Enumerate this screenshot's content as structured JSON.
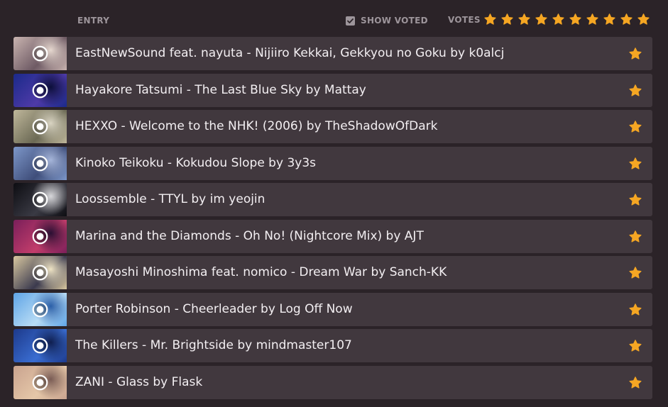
{
  "header": {
    "entry_label": "ENTRY",
    "show_voted_label": "SHOW VOTED",
    "show_voted_checked": true,
    "votes_label": "VOTES",
    "vote_scale_max": 10
  },
  "colors": {
    "background": "#2b2328",
    "row": "#41383e",
    "accent_star": "#f5a623",
    "muted_text": "#9d959b",
    "title_text": "#f3eff2"
  },
  "entries": [
    {
      "title": "EastNewSound feat. nayuta - Nijiiro Kekkai, Gekkyou no Goku by k0alcj",
      "thumb": [
        "#c9b4b0",
        "#6e5a64",
        "#e6d8cf"
      ],
      "voted": true
    },
    {
      "title": "Hayakore Tatsumi - The Last Blue Sky by Mattay",
      "thumb": [
        "#1b2a8a",
        "#4e3aa8",
        "#0c0f3a"
      ],
      "voted": true
    },
    {
      "title": "HEXXO - Welcome to the NHK! (2006) by TheShadowOfDark",
      "thumb": [
        "#bfb79b",
        "#6c6a55",
        "#d9d4c2"
      ],
      "voted": true
    },
    {
      "title": "Kinoko Teikoku - Kokudou Slope by 3y3s",
      "thumb": [
        "#7d97c9",
        "#3f4e7a",
        "#a6b6da"
      ],
      "voted": true
    },
    {
      "title": "Loossemble - TTYL by im yeojin",
      "thumb": [
        "#0d0d12",
        "#3a3a44",
        "#d7d7da"
      ],
      "voted": true
    },
    {
      "title": "Marina and the Diamonds - Oh No! (Nightcore Mix) by AJT",
      "thumb": [
        "#7a1f5a",
        "#c23d6b",
        "#2a0f33"
      ],
      "voted": true
    },
    {
      "title": "Masayoshi Minoshima feat. nomico - Dream War by Sanch-KK",
      "thumb": [
        "#d9c8a0",
        "#3b3a4e",
        "#efe4c4"
      ],
      "voted": true
    },
    {
      "title": "Porter Robinson - Cheerleader by Log Off Now",
      "thumb": [
        "#5fa4e6",
        "#b8dcf5",
        "#2b5fa8"
      ],
      "voted": true
    },
    {
      "title": "The Killers - Mr. Brightside by mindmaster107",
      "thumb": [
        "#1d3a8c",
        "#3a6dd1",
        "#0f1e4f"
      ],
      "voted": true
    },
    {
      "title": "ZANI - Glass by Flask",
      "thumb": [
        "#c9a38f",
        "#e5c7a8",
        "#7a5c55"
      ],
      "voted": true
    }
  ]
}
